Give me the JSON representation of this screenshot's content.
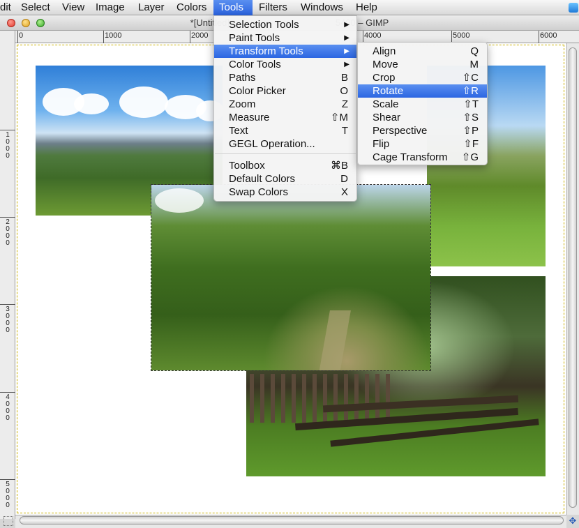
{
  "menubar": {
    "items": [
      "dit",
      "Select",
      "View",
      "Image",
      "Layer",
      "Colors",
      "Tools",
      "Filters",
      "Windows",
      "Help"
    ]
  },
  "window": {
    "title": "*[Untitled]                                          5400 – GIMP"
  },
  "ruler": {
    "h_labels": [
      "0",
      "1000",
      "2000",
      "4000",
      "5000",
      "6000"
    ],
    "v_labels": [
      "1000",
      "2000",
      "3000",
      "4000",
      "5000"
    ]
  },
  "tools_menu": {
    "items": [
      {
        "label": "Selection Tools",
        "shortcut": "",
        "submenu": true
      },
      {
        "label": "Paint Tools",
        "shortcut": "",
        "submenu": true
      },
      {
        "label": "Transform Tools",
        "shortcut": "",
        "submenu": true
      },
      {
        "label": "Color Tools",
        "shortcut": "",
        "submenu": true
      },
      {
        "label": "Paths",
        "shortcut": "B",
        "submenu": false
      },
      {
        "label": "Color Picker",
        "shortcut": "O",
        "submenu": false
      },
      {
        "label": "Zoom",
        "shortcut": "Z",
        "submenu": false
      },
      {
        "label": "Measure",
        "shortcut": "⇧M",
        "submenu": false
      },
      {
        "label": "Text",
        "shortcut": "T",
        "submenu": false
      },
      {
        "label": "GEGL Operation...",
        "shortcut": "",
        "submenu": false
      },
      {
        "label": "Toolbox",
        "shortcut": "⌘B",
        "submenu": false
      },
      {
        "label": "Default Colors",
        "shortcut": "D",
        "submenu": false
      },
      {
        "label": "Swap Colors",
        "shortcut": "X",
        "submenu": false
      }
    ],
    "highlighted": "Transform Tools"
  },
  "transform_menu": {
    "items": [
      {
        "label": "Align",
        "shortcut": "Q"
      },
      {
        "label": "Move",
        "shortcut": "M"
      },
      {
        "label": "Crop",
        "shortcut": "⇧C"
      },
      {
        "label": "Rotate",
        "shortcut": "⇧R"
      },
      {
        "label": "Scale",
        "shortcut": "⇧T"
      },
      {
        "label": "Shear",
        "shortcut": "⇧S"
      },
      {
        "label": "Perspective",
        "shortcut": "⇧P"
      },
      {
        "label": "Flip",
        "shortcut": "⇧F"
      },
      {
        "label": "Cage Transform",
        "shortcut": "⇧G"
      }
    ],
    "highlighted": "Rotate"
  },
  "colors": {
    "highlight": "#2c66e2",
    "canvas_bg": "#ffffff",
    "chrome": "#d6d6d6"
  }
}
